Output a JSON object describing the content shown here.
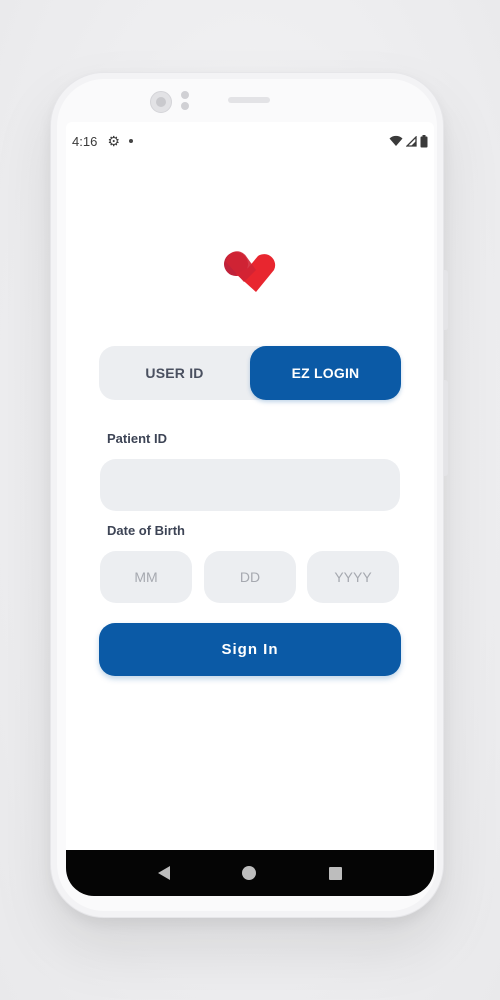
{
  "status_bar": {
    "time": "4:16",
    "settings_icon": "gear-icon",
    "notification_icon": "dot-icon",
    "wifi_icon": "wifi-icon",
    "signal_icon": "signal-icon",
    "battery_icon": "battery-icon"
  },
  "logo": {
    "icon": "heart-logo-icon",
    "colors": {
      "primary": "#e8262f",
      "secondary": "#c0223a"
    }
  },
  "login_toggle": {
    "user_id_label": "USER ID",
    "ez_login_label": "EZ LOGIN",
    "selected": "EZ LOGIN"
  },
  "form": {
    "patient_id_label": "Patient ID",
    "patient_id_value": "",
    "dob_label": "Date of Birth",
    "month_placeholder": "MM",
    "day_placeholder": "DD",
    "year_placeholder": "YYYY",
    "sign_in_label": "Sign In"
  },
  "nav_bar": {
    "back_icon": "back-triangle-icon",
    "home_icon": "home-circle-icon",
    "recents_icon": "recents-square-icon"
  },
  "colors": {
    "accent": "#0b5aa6",
    "field_bg": "#eceef1",
    "label_text": "#3d4455"
  }
}
